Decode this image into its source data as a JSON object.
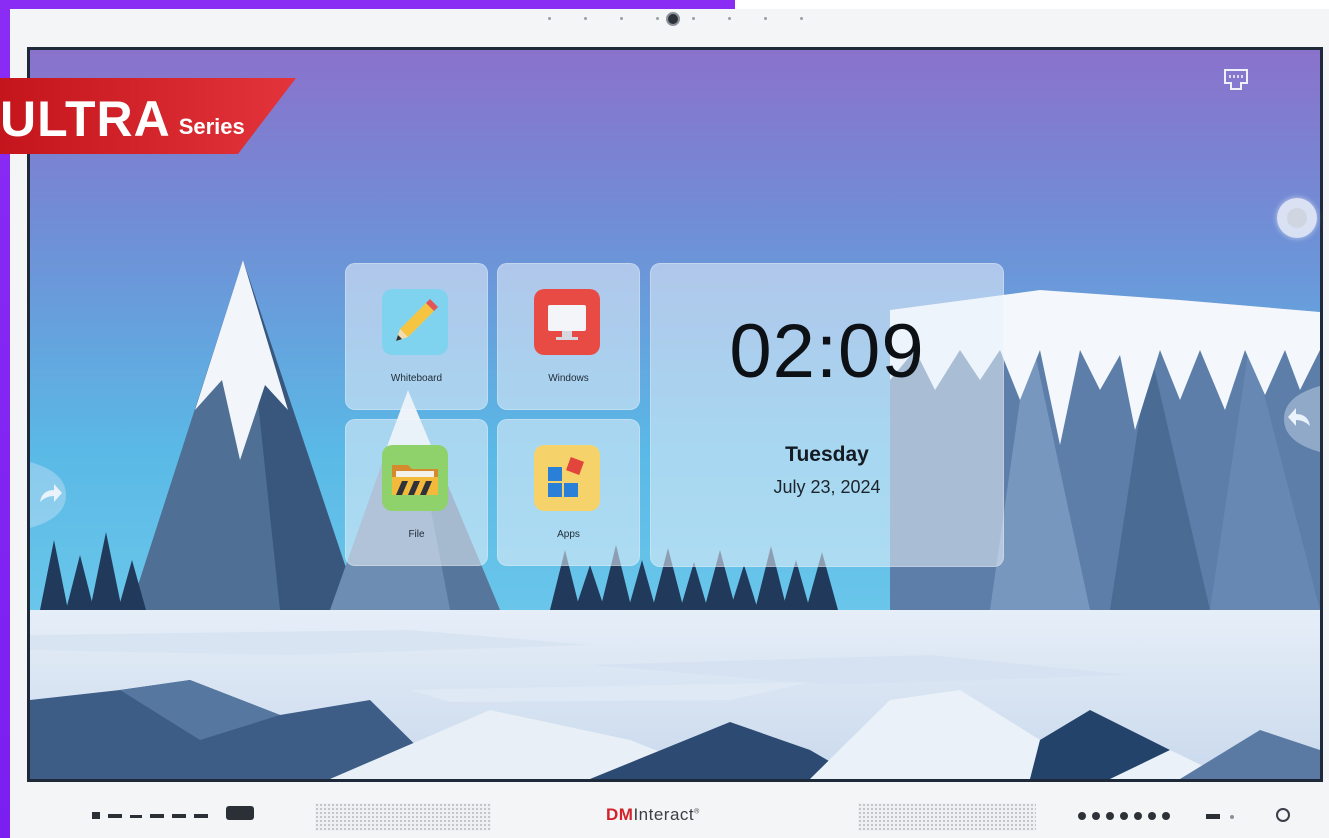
{
  "badge": {
    "main": "ULTRA",
    "sub": "Series"
  },
  "home": {
    "tiles": [
      {
        "label": "Whiteboard",
        "icon": "pencil-icon"
      },
      {
        "label": "Windows",
        "icon": "monitor-icon"
      },
      {
        "label": "File",
        "icon": "folder-icon"
      },
      {
        "label": "Apps",
        "icon": "apps-icon"
      }
    ],
    "clock": {
      "time": "02:09",
      "day": "Tuesday",
      "date": "July 23, 2024"
    }
  },
  "bezel": {
    "brand_prefix": "DM",
    "brand_suffix": "Interact",
    "trademark": "®"
  },
  "colors": {
    "purple_edge": "#8b2cf5",
    "badge_red": "#d2232a",
    "brand_red": "#d2232a"
  }
}
